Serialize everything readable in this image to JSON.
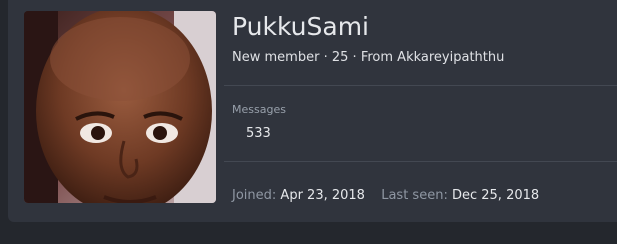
{
  "profile": {
    "username": "PukkuSami",
    "role": "New member",
    "age": "25",
    "location_prefix": "From",
    "location": "Akkareyipaththu",
    "separator": "·"
  },
  "stats": {
    "messages_label": "Messages",
    "messages_value": "533"
  },
  "footer": {
    "joined_label": "Joined:",
    "joined_value": "Apr 23, 2018",
    "last_seen_label": "Last seen:",
    "last_seen_value": "Dec 25, 2018"
  },
  "colors": {
    "page_bg": "#24272d",
    "card_bg": "#30343d",
    "text_primary": "#e6e8eb",
    "text_muted": "#8f97a3",
    "divider": "#434852"
  },
  "icons": {
    "avatar": "user-avatar-photo"
  }
}
